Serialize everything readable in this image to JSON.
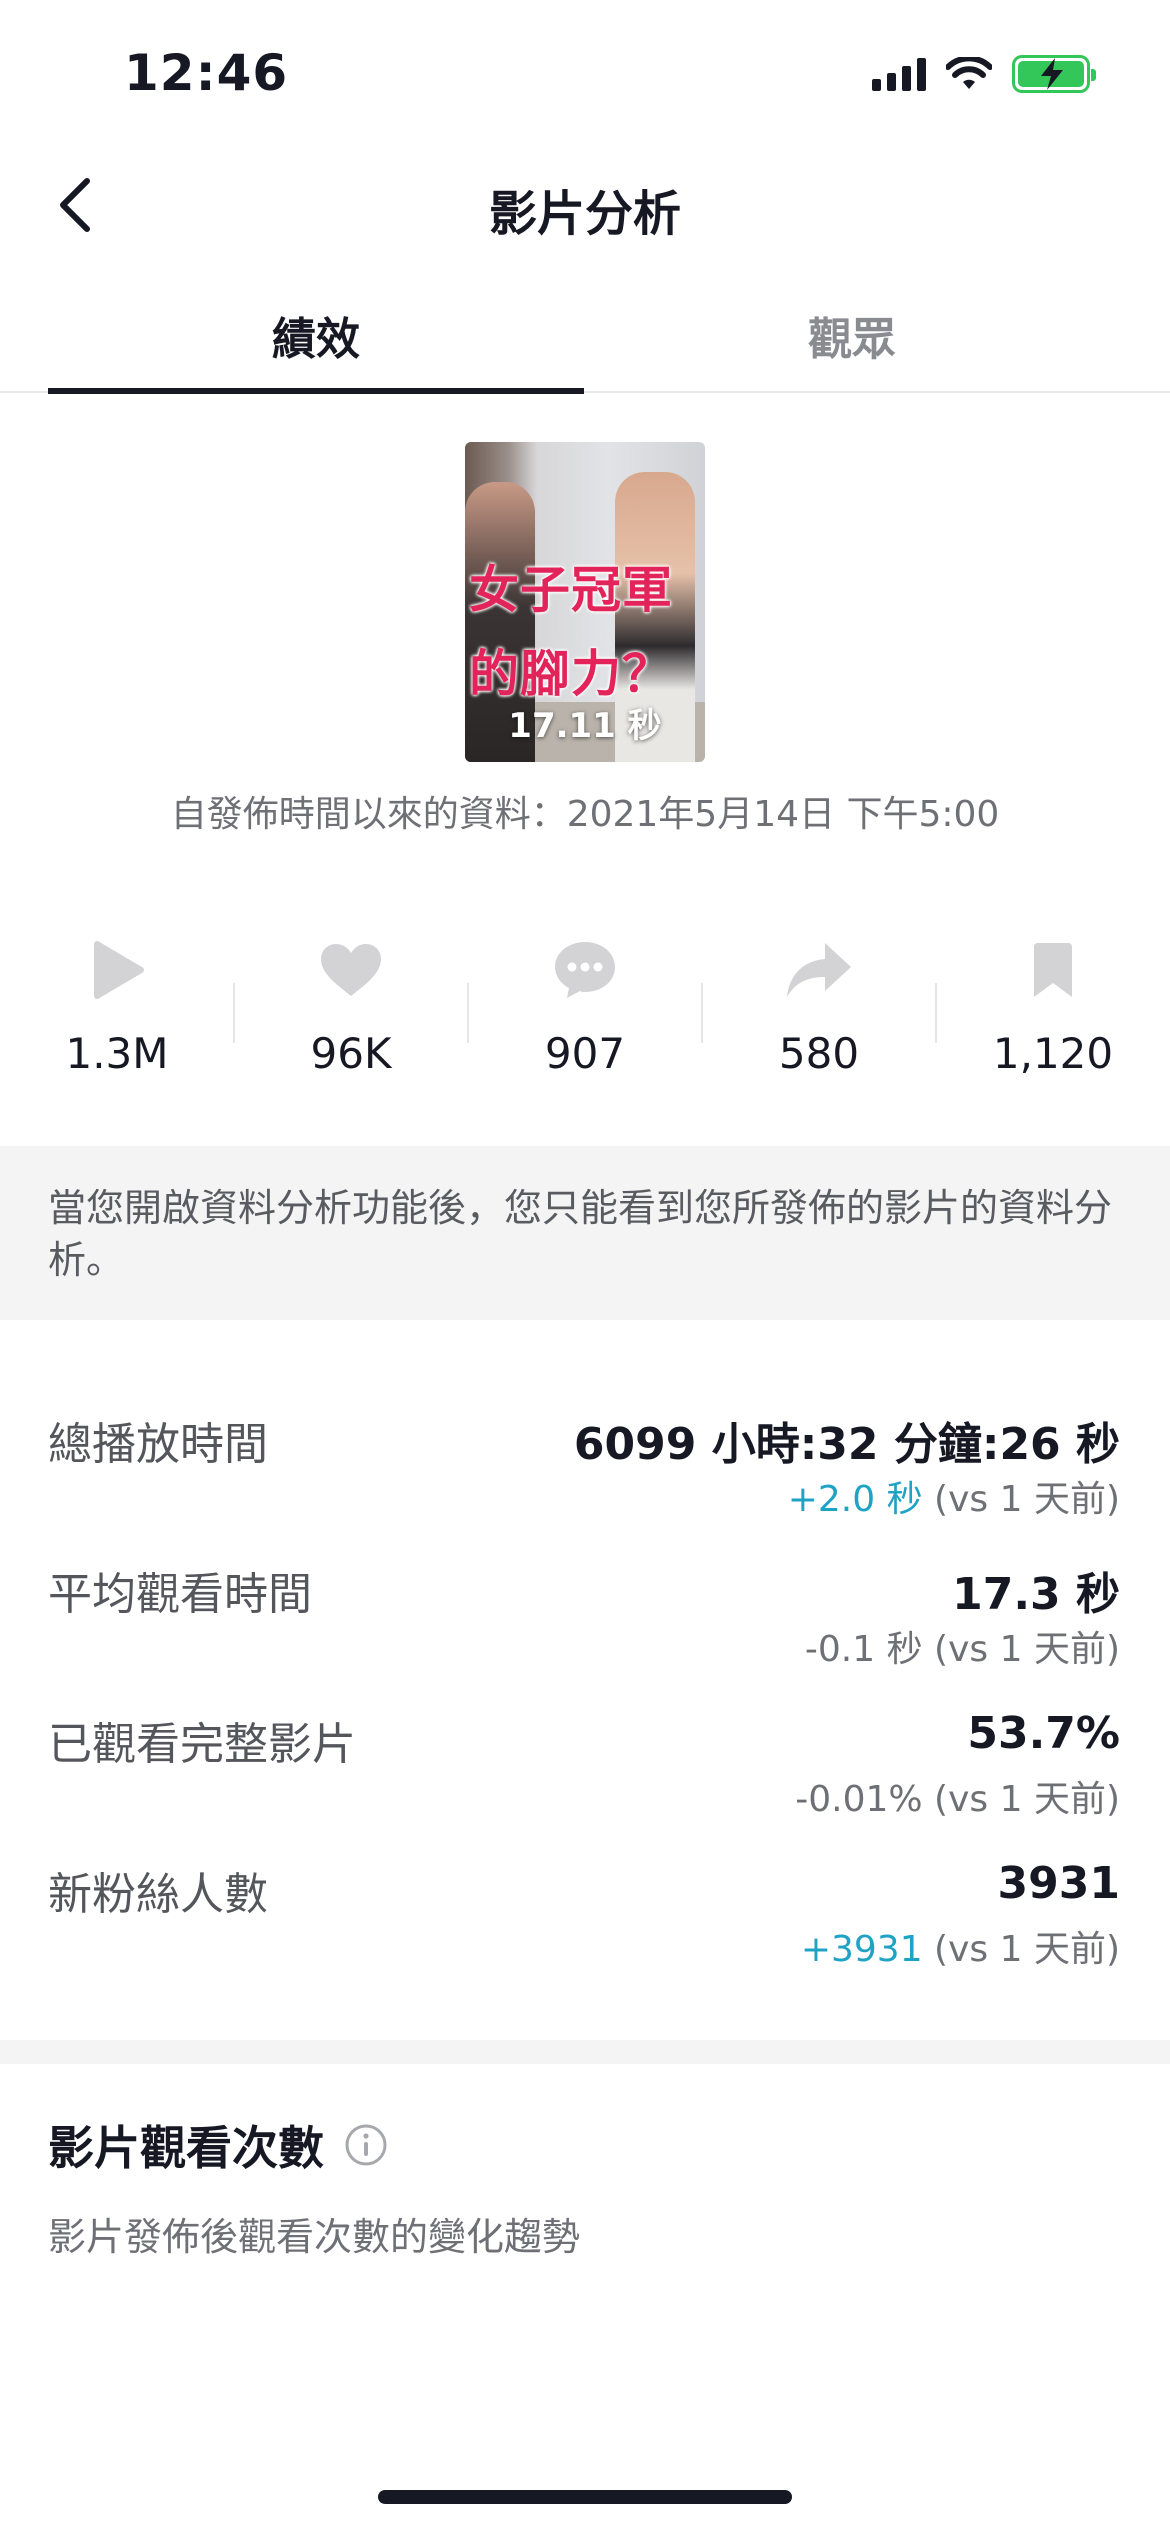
{
  "status_bar": {
    "time": "12:46"
  },
  "nav": {
    "title": "影片分析"
  },
  "tabs": [
    {
      "label": "績效",
      "active": true
    },
    {
      "label": "觀眾",
      "active": false
    }
  ],
  "video": {
    "thumbnail_text_line1": "女子冠軍",
    "thumbnail_text_line2": "的腳力？",
    "duration": "17.11 秒",
    "since_text": "自發佈時間以來的資料：2021年5月14日 下午5:00"
  },
  "stats": [
    {
      "icon": "play-icon",
      "value": "1.3M"
    },
    {
      "icon": "heart-icon",
      "value": "96K"
    },
    {
      "icon": "comment-icon",
      "value": "907"
    },
    {
      "icon": "share-icon",
      "value": "580"
    },
    {
      "icon": "bookmark-icon",
      "value": "1,120"
    }
  ],
  "notice": "當您開啟資料分析功能後，您只能看到您所發佈的影片的資料分析。",
  "metrics": [
    {
      "label": "總播放時間",
      "value": "6099 小時:32 分鐘:26 秒",
      "change": "+2.0 秒",
      "compare": "(vs 1 天前)",
      "change_positive": true
    },
    {
      "label": "平均觀看時間",
      "value": "17.3 秒",
      "change": "-0.1 秒",
      "compare": "(vs 1 天前)",
      "change_positive": false
    },
    {
      "label": "已觀看完整影片",
      "value": "53.7%",
      "change": "-0.01%",
      "compare": "(vs 1 天前)",
      "change_positive": false
    },
    {
      "label": "新粉絲人數",
      "value": "3931",
      "change": "+3931",
      "compare": "(vs 1 天前)",
      "change_positive": true
    }
  ],
  "views_section": {
    "title": "影片觀看次數",
    "subtitle": "影片發佈後觀看次數的變化趨勢"
  },
  "colors": {
    "text_primary": "#161823",
    "text_secondary": "#6f7076",
    "positive_change": "#1fa3c4",
    "battery": "#33c759",
    "thumbnail_text": "#e3245a"
  }
}
